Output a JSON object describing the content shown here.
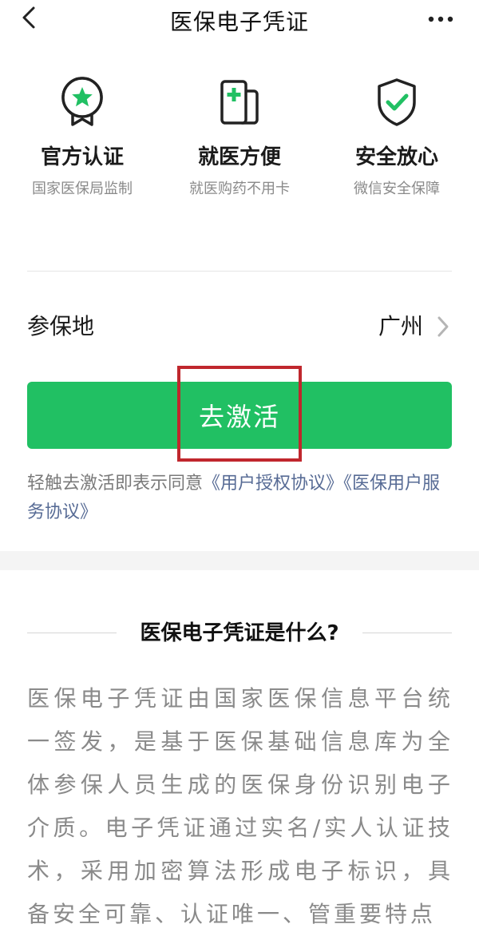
{
  "header": {
    "title": "医保电子凭证",
    "back_icon": "chevron-left-icon",
    "more_icon": "more-dots-icon"
  },
  "features": [
    {
      "icon": "badge-star-icon",
      "title": "官方认证",
      "desc": "国家医保局监制"
    },
    {
      "icon": "medical-card-icon",
      "title": "就医方便",
      "desc": "就医购药不用卡"
    },
    {
      "icon": "shield-check-icon",
      "title": "安全放心",
      "desc": "微信安全保障"
    }
  ],
  "location": {
    "label": "参保地",
    "value": "广州"
  },
  "activate_button": {
    "label": "去激活"
  },
  "agreement": {
    "prefix": "轻触去激活即表示同意",
    "link1": "《用户授权协议》",
    "link2": "《医保用户服务协议》"
  },
  "section": {
    "title": "医保电子凭证是什么?",
    "body": "医保电子凭证由国家医保信息平台统一签发，是基于医保基础信息库为全体参保人员生成的医保身份识别电子介质。电子凭证通过实名/实人认证技术，采用加密算法形成电子标识，具备安全可靠、认证唯一、管重要特点"
  },
  "colors": {
    "accent": "#21c063",
    "link": "#576b95",
    "highlight": "#c0272d"
  }
}
